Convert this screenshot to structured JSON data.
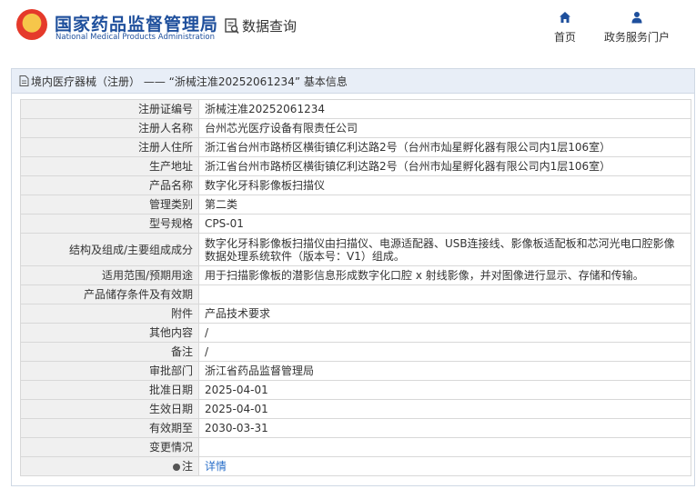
{
  "header": {
    "brand_cn": "国家药品监督管理局",
    "brand_en": "National Medical Products Administration",
    "query_label": "数据查询",
    "nav": [
      {
        "label": "首页",
        "icon": "home-icon"
      },
      {
        "label": "政务服务门户",
        "icon": "user-icon"
      }
    ],
    "accent_color": "#1e4f9c"
  },
  "panel": {
    "title": "境内医疗器械（注册） ——  “浙械注准20252061234” 基本信息"
  },
  "rows": [
    {
      "label": "注册证编号",
      "value": "浙械注准20252061234"
    },
    {
      "label": "注册人名称",
      "value": "台州芯光医疗设备有限责任公司"
    },
    {
      "label": "注册人住所",
      "value": "浙江省台州市路桥区横街镇亿利达路2号（台州市灿星孵化器有限公司内1层106室）"
    },
    {
      "label": "生产地址",
      "value": "浙江省台州市路桥区横街镇亿利达路2号（台州市灿星孵化器有限公司内1层106室）"
    },
    {
      "label": "产品名称",
      "value": "数字化牙科影像板扫描仪"
    },
    {
      "label": "管理类别",
      "value": "第二类"
    },
    {
      "label": "型号规格",
      "value": "CPS-01"
    },
    {
      "label": "结构及组成/主要组成成分",
      "value": "数字化牙科影像板扫描仪由扫描仪、电源适配器、USB连接线、影像板适配板和芯河光电口腔影像数据处理系统软件（版本号：V1）组成。"
    },
    {
      "label": "适用范围/预期用途",
      "value": "用于扫描影像板的潜影信息形成数字化口腔 x 射线影像，并对图像进行显示、存储和传输。"
    },
    {
      "label": "产品储存条件及有效期",
      "value": ""
    },
    {
      "label": "附件",
      "value": "产品技术要求"
    },
    {
      "label": "其他内容",
      "value": "/"
    },
    {
      "label": "备注",
      "value": "/"
    },
    {
      "label": "审批部门",
      "value": "浙江省药品监督管理局"
    },
    {
      "label": "批准日期",
      "value": "2025-04-01"
    },
    {
      "label": "生效日期",
      "value": "2025-04-01"
    },
    {
      "label": "有效期至",
      "value": "2030-03-31"
    },
    {
      "label": "变更情况",
      "value": ""
    }
  ],
  "note_row": {
    "label": "注",
    "link": "详情"
  }
}
